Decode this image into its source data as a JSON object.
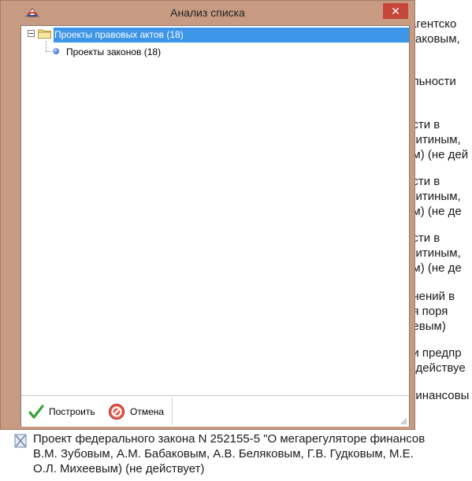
{
  "window": {
    "title": "Анализ списка",
    "close_glyph": "✕"
  },
  "tree": {
    "root_label": "Проекты правовых актов (18)",
    "child_label": "Проекты законов (18)"
  },
  "footer": {
    "build_label": "Построить",
    "cancel_label": "Отмена"
  },
  "background": {
    "right_fragments": [
      "(агентско",
      "шаковым,",
      "ельности",
      "ости в",
      "Митиным,",
      "им) (не дей",
      "ости в",
      "Митиным,",
      "им) (не де",
      "ости в",
      "Митиным,",
      "им) (не де",
      "енений в",
      "ия     поря",
      "цевым)",
      "ии  предпр",
      "е действуе",
      "финансовы"
    ],
    "bottom_lines": [
      "Проект федерального закона N 252155-5 \"О мегарегуляторе финансов",
      "В.М. Зубовым, А.М. Бабаковым, А.В. Беляковым, Г.В. Гудковым, М.Е.",
      "О.Л. Михеевым) (не действует)"
    ]
  },
  "colors": {
    "dialog_frame": "#c79a82",
    "selection": "#3c95e8",
    "close_button": "#c7463b"
  }
}
